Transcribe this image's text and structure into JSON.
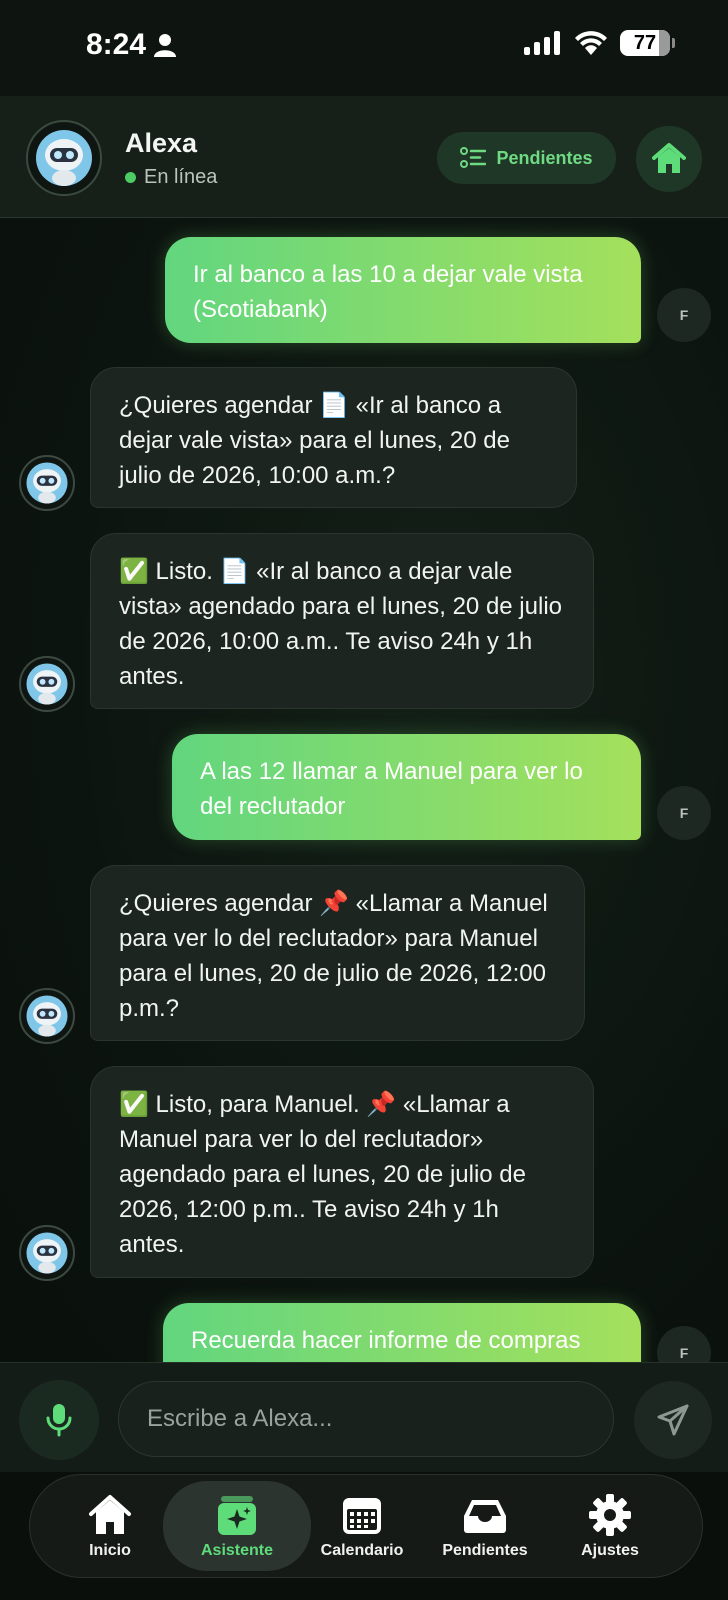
{
  "status_bar": {
    "time": "8:24",
    "battery": "77"
  },
  "header": {
    "name": "Alexa",
    "status": "En línea",
    "pending_button": "Pendientes"
  },
  "messages": [
    {
      "from": "user",
      "avatar": "F",
      "text": "Ir al banco a las 10 a dejar vale vista (Scotiabank)"
    },
    {
      "from": "bot",
      "text": "¿Quieres agendar 📄 «Ir al banco a dejar vale vista» para el lunes, 20 de julio de 2026, 10:00 a.m.?"
    },
    {
      "from": "bot",
      "text": "✅ Listo. 📄 «Ir al banco a dejar vale vista» agendado para el lunes, 20 de julio de 2026, 10:00 a.m.. Te aviso 24h y 1h antes."
    },
    {
      "from": "user",
      "avatar": "F",
      "text": "A las 12 llamar a Manuel para ver lo del reclutador"
    },
    {
      "from": "bot",
      "text": "¿Quieres agendar 📌 «Llamar a Manuel para ver lo del reclutador» para Manuel para el lunes, 20 de julio de 2026, 12:00 p.m.?"
    },
    {
      "from": "bot",
      "text": "✅ Listo, para Manuel. 📌 «Llamar a Manuel para ver lo del reclutador» agendado para el lunes, 20 de julio de 2026, 12:00 p.m.. Te aviso 24h y 1h antes."
    },
    {
      "from": "user",
      "avatar": "F",
      "text": "Recuerda hacer informe de compras"
    }
  ],
  "input": {
    "placeholder": "Escribe a Alexa..."
  },
  "tabs": [
    {
      "label": "Inicio",
      "icon": "home-icon"
    },
    {
      "label": "Asistente",
      "icon": "assistant-icon",
      "active": true
    },
    {
      "label": "Calendario",
      "icon": "calendar-icon"
    },
    {
      "label": "Pendientes",
      "icon": "inbox-icon"
    },
    {
      "label": "Ajustes",
      "icon": "gear-icon"
    }
  ],
  "colors": {
    "accent": "#5fdc7a",
    "user_bubble_start": "#62d67f",
    "user_bubble_end": "#a4e05c",
    "bot_bubble": "#1c251f",
    "background": "#0c140f"
  }
}
